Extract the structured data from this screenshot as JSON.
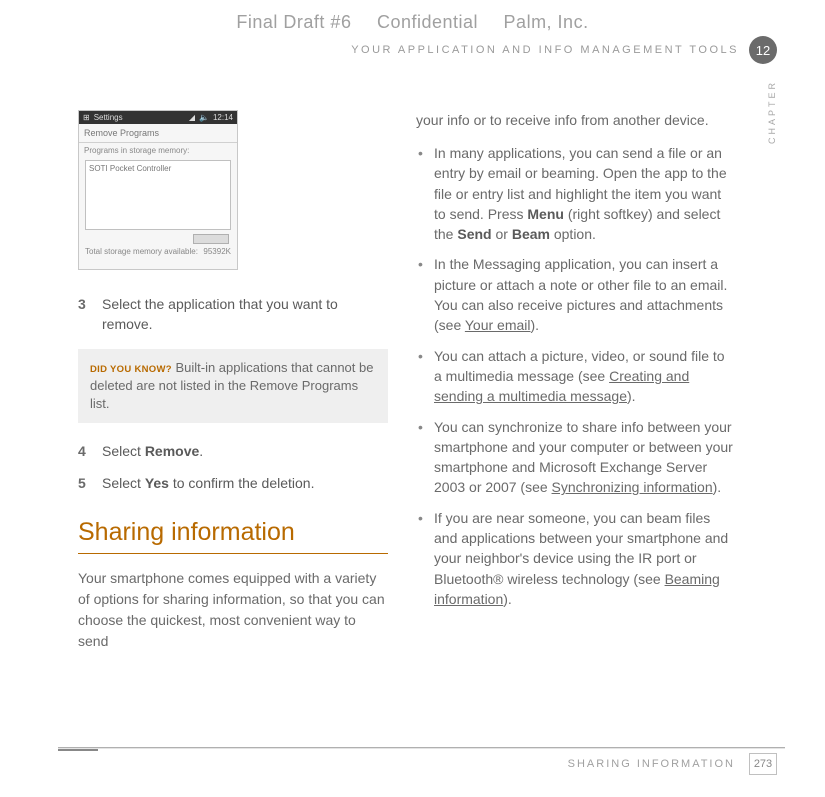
{
  "topline": {
    "draft": "Final Draft #6",
    "conf": "Confidential",
    "company": "Palm, Inc."
  },
  "runningHead": "YOUR APPLICATION AND INFO MANAGEMENT TOOLS",
  "chapterNumber": "12",
  "chapterLabel": "CHAPTER",
  "screenshot": {
    "settingsLabel": "Settings",
    "time": "12:14",
    "title": "Remove Programs",
    "subtitle": "Programs in storage memory:",
    "listItem": "SOTI Pocket Controller",
    "totalLabel": "Total storage memory available:",
    "totalValue": "95392K"
  },
  "steps": {
    "s3": {
      "num": "3",
      "text": "Select the application that you want to remove."
    },
    "s4": {
      "num": "4",
      "prefix": "Select ",
      "bold": "Remove",
      "suffix": "."
    },
    "s5": {
      "num": "5",
      "prefix": "Select ",
      "bold": "Yes",
      "suffix": " to confirm the deletion."
    }
  },
  "tip": {
    "label": "DID YOU KNOW?",
    "text": " Built-in applications that cannot be deleted are not listed in the Remove Programs list."
  },
  "sectionHeading": "Sharing information",
  "leftPara": "Your smartphone comes equipped with a variety of options for sharing information, so that you can choose the quickest, most convenient way to send",
  "rightPara": "your info or to receive info from another device.",
  "bullets": {
    "b1": {
      "a": "In many applications, you can send a file or an entry by email or beaming. Open the app to the file or entry list and highlight the item you want to send. Press ",
      "b1": "Menu",
      "c": " (right softkey) and select the ",
      "b2": "Send",
      "d": " or ",
      "b3": "Beam",
      "e": " option."
    },
    "b2": {
      "a": "In the Messaging application, you can insert a picture or attach a note or other file to an email. You can also receive pictures and attachments (see ",
      "link": "Your email",
      "b": ")."
    },
    "b3": {
      "a": "You can attach a picture, video, or sound file to a multimedia message (see ",
      "link": "Creating and sending a multimedia message",
      "b": ")."
    },
    "b4": {
      "a": "You can synchronize to share info between your smartphone and your computer or between your smartphone and Microsoft Exchange Server 2003 or 2007 (see ",
      "link": "Synchronizing information",
      "b": ")."
    },
    "b5": {
      "a": "If you are near someone, you can beam files and applications between your smartphone and your neighbor's device using the IR port or Bluetooth® wireless technology (see ",
      "link": "Beaming information",
      "b": ")."
    }
  },
  "footer": {
    "section": "SHARING INFORMATION",
    "page": "273"
  }
}
